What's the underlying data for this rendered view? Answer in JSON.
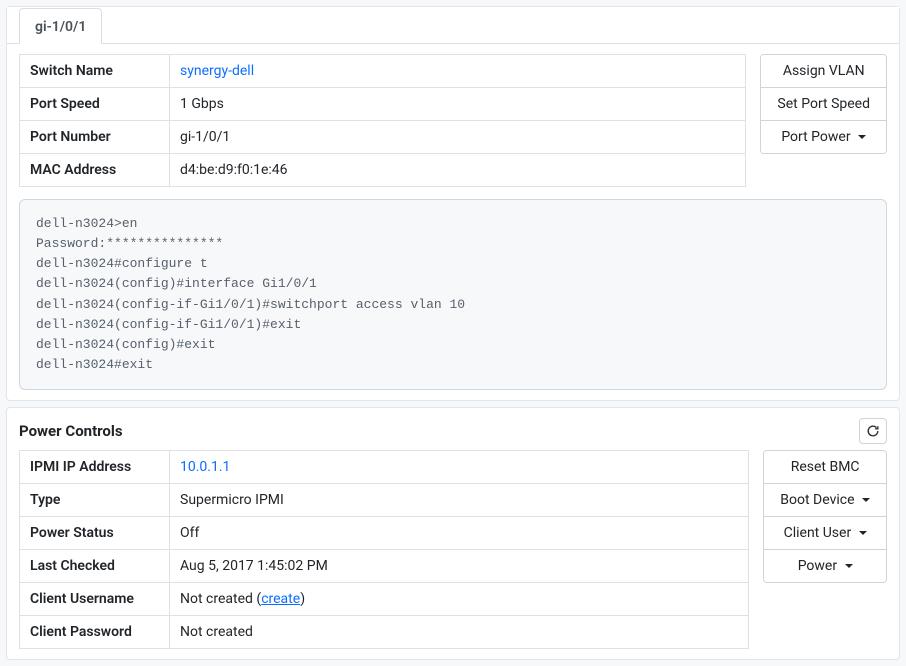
{
  "port_tab": {
    "label": "gi-1/0/1"
  },
  "port_info": {
    "rows": [
      {
        "label": "Switch Name",
        "value": "synergy-dell",
        "is_link": true
      },
      {
        "label": "Port Speed",
        "value": "1 Gbps"
      },
      {
        "label": "Port Number",
        "value": "gi-1/0/1"
      },
      {
        "label": "MAC Address",
        "value": "d4:be:d9:f0:1e:46"
      }
    ]
  },
  "port_actions": {
    "assign_vlan": "Assign VLAN",
    "set_port_speed": "Set Port Speed",
    "port_power": "Port Power"
  },
  "terminal_output": "dell-n3024>en\nPassword:***************\ndell-n3024#configure t\ndell-n3024(config)#interface Gi1/0/1\ndell-n3024(config-if-Gi1/0/1)#switchport access vlan 10\ndell-n3024(config-if-Gi1/0/1)#exit\ndell-n3024(config)#exit\ndell-n3024#exit",
  "power_panel": {
    "title": "Power Controls",
    "rows": {
      "ipmi_ip": {
        "label": "IPMI IP Address",
        "value": "10.0.1.1",
        "is_link": true
      },
      "type": {
        "label": "Type",
        "value": "Supermicro IPMI"
      },
      "power_status": {
        "label": "Power Status",
        "value": "Off"
      },
      "last_checked": {
        "label": "Last Checked",
        "value": "Aug 5, 2017 1:45:02 PM"
      },
      "client_user": {
        "label": "Client Username",
        "value": "Not created",
        "create_label": "create"
      },
      "client_pass": {
        "label": "Client Password",
        "value": "Not created"
      }
    }
  },
  "power_actions": {
    "reset_bmc": "Reset BMC",
    "boot_device": "Boot Device",
    "client_user": "Client User",
    "power": "Power"
  }
}
